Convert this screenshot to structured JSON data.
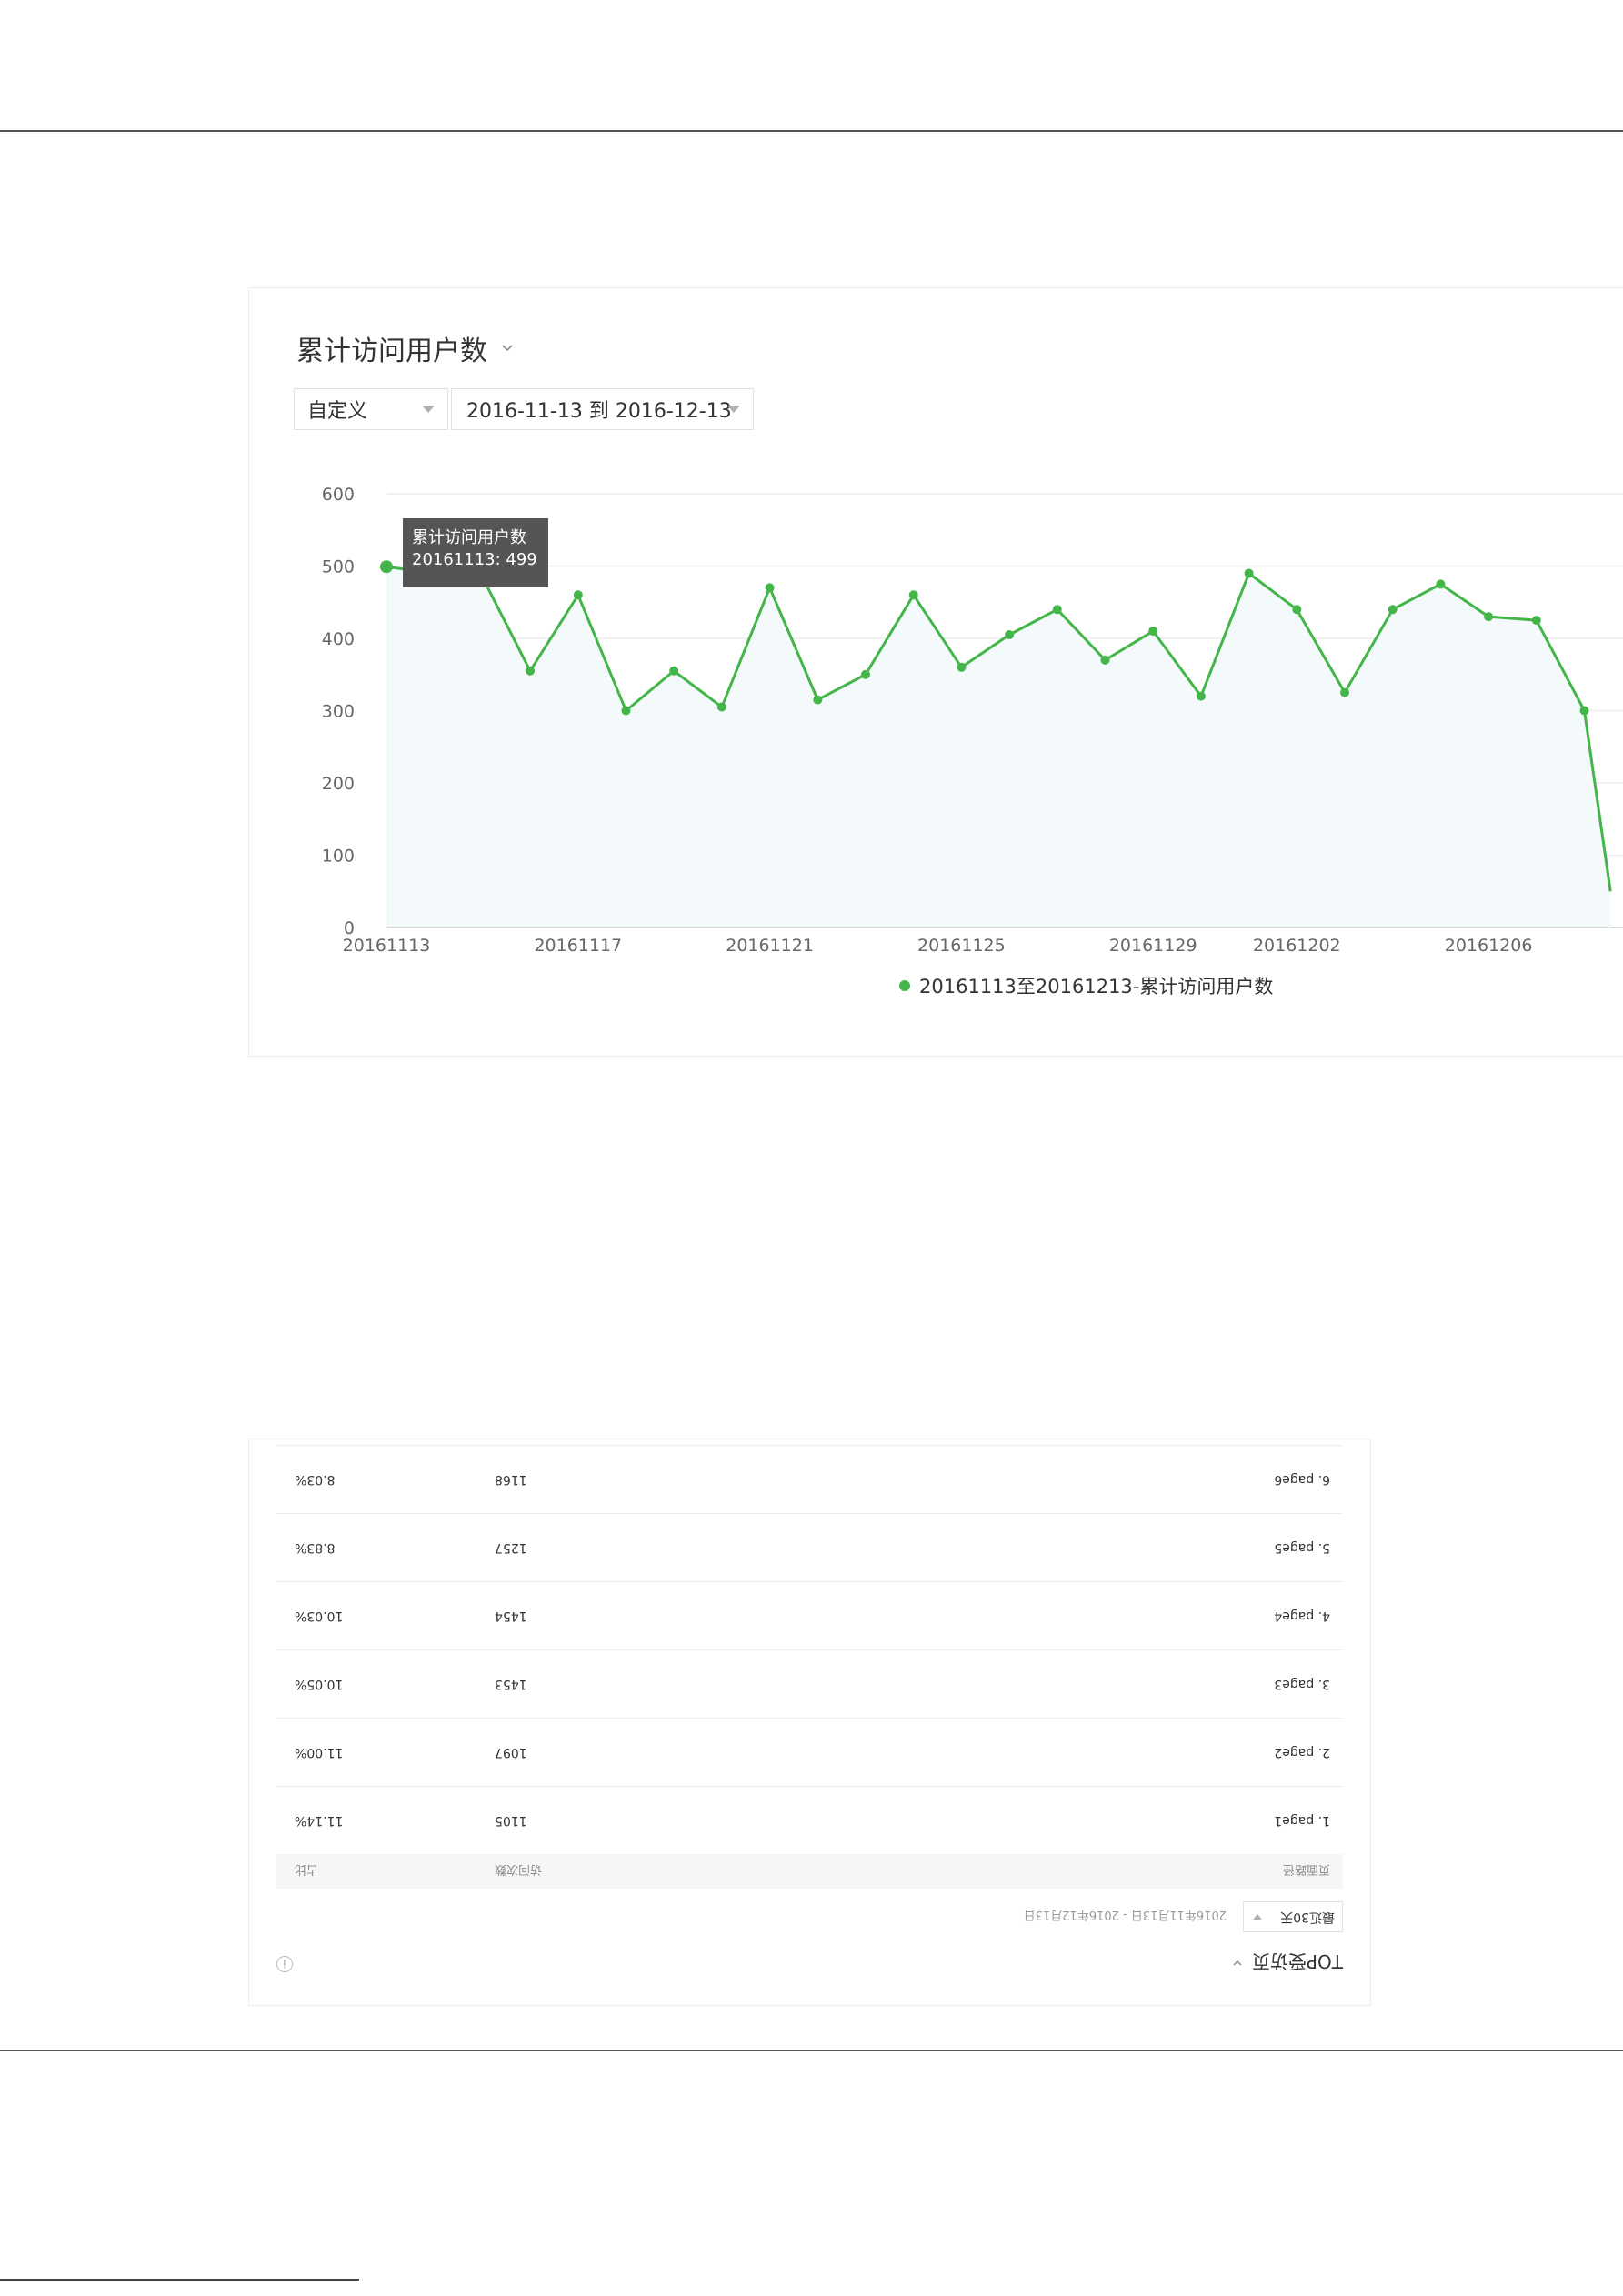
{
  "chart_panel": {
    "title": "累计访问用户数",
    "range_select": "自定义",
    "date_range": "2016-11-13 到 2016-12-13",
    "tooltip": {
      "series": "累计访问用户数",
      "value_line": "20161113: 499"
    },
    "legend": "20161113至20161213-累计访问用户数",
    "accent_color": "#44b549"
  },
  "chart_data": {
    "type": "line",
    "title": "累计访问用户数",
    "xlabel": "",
    "ylabel": "",
    "ylim": [
      0,
      600
    ],
    "yticks": [
      0,
      100,
      200,
      300,
      400,
      500,
      600
    ],
    "xtick_labels": [
      "20161113",
      "20161117",
      "20161121",
      "20161125",
      "20161129",
      "20161202",
      "20161206"
    ],
    "grid": true,
    "legend_position": "bottom",
    "series": [
      {
        "name": "20161113至20161213-累计访问用户数",
        "color": "#44b549",
        "x": [
          "20161113",
          "20161114",
          "20161115",
          "20161116",
          "20161117",
          "20161118",
          "20161119",
          "20161120",
          "20161121",
          "20161122",
          "20161123",
          "20161124",
          "20161125",
          "20161126",
          "20161127",
          "20161128",
          "20161129",
          "20161130",
          "20161201",
          "20161202",
          "20161203",
          "20161204",
          "20161205",
          "20161206",
          "20161207",
          "20161208"
        ],
        "values": [
          499,
          490,
          485,
          355,
          460,
          300,
          355,
          305,
          470,
          315,
          350,
          460,
          360,
          405,
          440,
          370,
          410,
          320,
          490,
          440,
          325,
          440,
          475,
          430,
          425,
          300
        ]
      }
    ],
    "note": "Series continues beyond the visible frame; last visible values drop sharply to about 50."
  },
  "table_panel": {
    "title": "TOP受访页",
    "period_select": "最近30天",
    "date_range": "2016年11月13日 - 2016年12月13日",
    "columns": [
      "页面路径",
      "访问次数",
      "占比"
    ],
    "rows": [
      [
        "1. page1",
        "1105",
        "11.14%"
      ],
      [
        "2. page2",
        "1097",
        "11.00%"
      ],
      [
        "3. page3",
        "1453",
        "10.05%"
      ],
      [
        "4. page4",
        "1454",
        "10.03%"
      ],
      [
        "5. page5",
        "1257",
        "8.83%"
      ],
      [
        "6. page6",
        "1168",
        "8.03%"
      ]
    ]
  }
}
